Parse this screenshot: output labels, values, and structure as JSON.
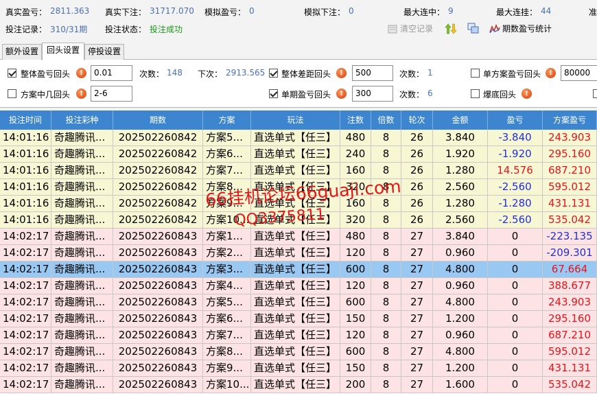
{
  "stats": {
    "real_profit_label": "真实盈亏：",
    "real_profit_value": "2811.363",
    "real_bet_label": "真实下注：",
    "real_bet_value": "31717.070",
    "sim_profit_label": "模拟盈亏：",
    "sim_profit_value": "0",
    "sim_bet_label": "模拟下注：",
    "sim_bet_value": "0",
    "max_streak_label": "最大连中：",
    "max_streak_value": "9",
    "max_lose_label": "最大连挂：",
    "max_lose_value": "44",
    "cut_label": "准",
    "record_label": "投注记录：",
    "record_value": "310/31期",
    "status_label": "投注状态：",
    "status_value": "投注成功"
  },
  "toolbar": {
    "clear_label": "清空记录",
    "stats_label": "期数盈亏统计"
  },
  "tabs": [
    "额外设置",
    "回头设置",
    "停投设置"
  ],
  "settings": {
    "overall_profit_label": "整体盈亏回头",
    "overall_profit_value": "0.01",
    "count1_label": "次数：",
    "count1_value": "148",
    "next_label": "下次：",
    "next_value": "2913.565",
    "overall_diff_label": "整体差距回头",
    "overall_diff_value": "500",
    "count2_label": "次数：",
    "count2_value": "1",
    "single_plan_label": "单方案盈亏回头",
    "single_plan_value": "80000",
    "plan_hit_label": "方案中几回头",
    "plan_hit_value": "2-6",
    "single_period_label": "单期盈亏回头",
    "single_period_value": "300",
    "count3_label": "次数：",
    "count3_value": "6",
    "bottom_label": "爆底回头"
  },
  "table": {
    "headers": [
      "投注时间",
      "投注彩种",
      "期数",
      "方案",
      "玩法",
      "注数",
      "倍数",
      "轮次",
      "金额",
      "盈亏",
      "方案盈亏"
    ],
    "rows": [
      {
        "time": "14:01:16",
        "lottery": "奇趣腾讯...",
        "period": "202502260842",
        "plan": "方案5...",
        "play": "直选单式【任三】",
        "notes": "480",
        "mult": "8",
        "round": "26",
        "amount": "3.840",
        "profit": "-3.840",
        "plan_profit": "243.903",
        "group": "a"
      },
      {
        "time": "14:01:16",
        "lottery": "奇趣腾讯...",
        "period": "202502260842",
        "plan": "方案6...",
        "play": "直选单式【任三】",
        "notes": "240",
        "mult": "8",
        "round": "26",
        "amount": "1.920",
        "profit": "-1.920",
        "plan_profit": "295.160",
        "group": "a"
      },
      {
        "time": "14:01:16",
        "lottery": "奇趣腾讯...",
        "period": "202502260842",
        "plan": "方案7...",
        "play": "直选单式【任三】",
        "notes": "160",
        "mult": "8",
        "round": "26",
        "amount": "1.280",
        "profit": "14.576",
        "plan_profit": "687.210",
        "group": "a"
      },
      {
        "time": "14:01:16",
        "lottery": "奇趣腾讯...",
        "period": "202502260842",
        "plan": "方案8...",
        "play": "直选单式【任三】",
        "notes": "320",
        "mult": "8",
        "round": "26",
        "amount": "2.560",
        "profit": "-2.560",
        "plan_profit": "595.012",
        "group": "a"
      },
      {
        "time": "14:01:16",
        "lottery": "奇趣腾讯...",
        "period": "202502260842",
        "plan": "方案9...",
        "play": "直选单式【任三】",
        "notes": "160",
        "mult": "8",
        "round": "26",
        "amount": "1.280",
        "profit": "-1.280",
        "plan_profit": "431.131",
        "group": "a"
      },
      {
        "time": "14:01:16",
        "lottery": "奇趣腾讯...",
        "period": "202502260842",
        "plan": "方案10...",
        "play": "直选单式【任三】",
        "notes": "320",
        "mult": "8",
        "round": "26",
        "amount": "2.560",
        "profit": "-2.560",
        "plan_profit": "535.042",
        "group": "a"
      },
      {
        "time": "14:02:17",
        "lottery": "奇趣腾讯...",
        "period": "202502260843",
        "plan": "方案1...",
        "play": "直选单式【任三】",
        "notes": "480",
        "mult": "8",
        "round": "27",
        "amount": "3.840",
        "profit": "0",
        "plan_profit": "-223.135",
        "group": "b"
      },
      {
        "time": "14:02:17",
        "lottery": "奇趣腾讯...",
        "period": "202502260843",
        "plan": "方案2...",
        "play": "直选单式【任三】",
        "notes": "120",
        "mult": "8",
        "round": "27",
        "amount": "0.960",
        "profit": "0",
        "plan_profit": "-209.301",
        "group": "b"
      },
      {
        "time": "14:02:17",
        "lottery": "奇趣腾讯...",
        "period": "202502260843",
        "plan": "方案3...",
        "play": "直选单式【任三】",
        "notes": "600",
        "mult": "8",
        "round": "27",
        "amount": "4.800",
        "profit": "0",
        "plan_profit": "67.664",
        "group": "sel"
      },
      {
        "time": "14:02:17",
        "lottery": "奇趣腾讯...",
        "period": "202502260843",
        "plan": "方案4...",
        "play": "直选单式【任三】",
        "notes": "120",
        "mult": "8",
        "round": "27",
        "amount": "0.960",
        "profit": "0",
        "plan_profit": "388.677",
        "group": "b"
      },
      {
        "time": "14:02:17",
        "lottery": "奇趣腾讯...",
        "period": "202502260843",
        "plan": "方案5...",
        "play": "直选单式【任三】",
        "notes": "600",
        "mult": "8",
        "round": "27",
        "amount": "4.800",
        "profit": "0",
        "plan_profit": "243.903",
        "group": "b"
      },
      {
        "time": "14:02:17",
        "lottery": "奇趣腾讯...",
        "period": "202502260843",
        "plan": "方案6...",
        "play": "直选单式【任三】",
        "notes": "150",
        "mult": "8",
        "round": "27",
        "amount": "1.200",
        "profit": "0",
        "plan_profit": "295.160",
        "group": "b"
      },
      {
        "time": "14:02:17",
        "lottery": "奇趣腾讯...",
        "period": "202502260843",
        "plan": "方案7...",
        "play": "直选单式【任三】",
        "notes": "120",
        "mult": "8",
        "round": "27",
        "amount": "0.960",
        "profit": "0",
        "plan_profit": "687.210",
        "group": "b"
      },
      {
        "time": "14:02:17",
        "lottery": "奇趣腾讯...",
        "period": "202502260843",
        "plan": "方案8...",
        "play": "直选单式【任三】",
        "notes": "600",
        "mult": "8",
        "round": "27",
        "amount": "4.800",
        "profit": "0",
        "plan_profit": "595.012",
        "group": "b"
      },
      {
        "time": "14:02:17",
        "lottery": "奇趣腾讯...",
        "period": "202502260843",
        "plan": "方案9...",
        "play": "直选单式【任三】",
        "notes": "150",
        "mult": "8",
        "round": "27",
        "amount": "1.200",
        "profit": "0",
        "plan_profit": "431.131",
        "group": "b"
      },
      {
        "time": "14:02:17",
        "lottery": "奇趣腾讯...",
        "period": "202502260843",
        "plan": "方案10...",
        "play": "直选单式【任三】",
        "notes": "200",
        "mult": "8",
        "round": "27",
        "amount": "1.600",
        "profit": "0",
        "plan_profit": "535.042",
        "group": "b"
      }
    ]
  },
  "colors": {
    "header_bg": "#3d86cf",
    "row_a": "#f7f7d4",
    "row_b": "#fde3e3",
    "row_selected": "#99c9f3",
    "negative": "#1f2fd6",
    "positive": "#e3141b"
  },
  "watermark": {
    "line1": "66挂机论坛66guaji.com",
    "line2": "QQ3375811"
  }
}
